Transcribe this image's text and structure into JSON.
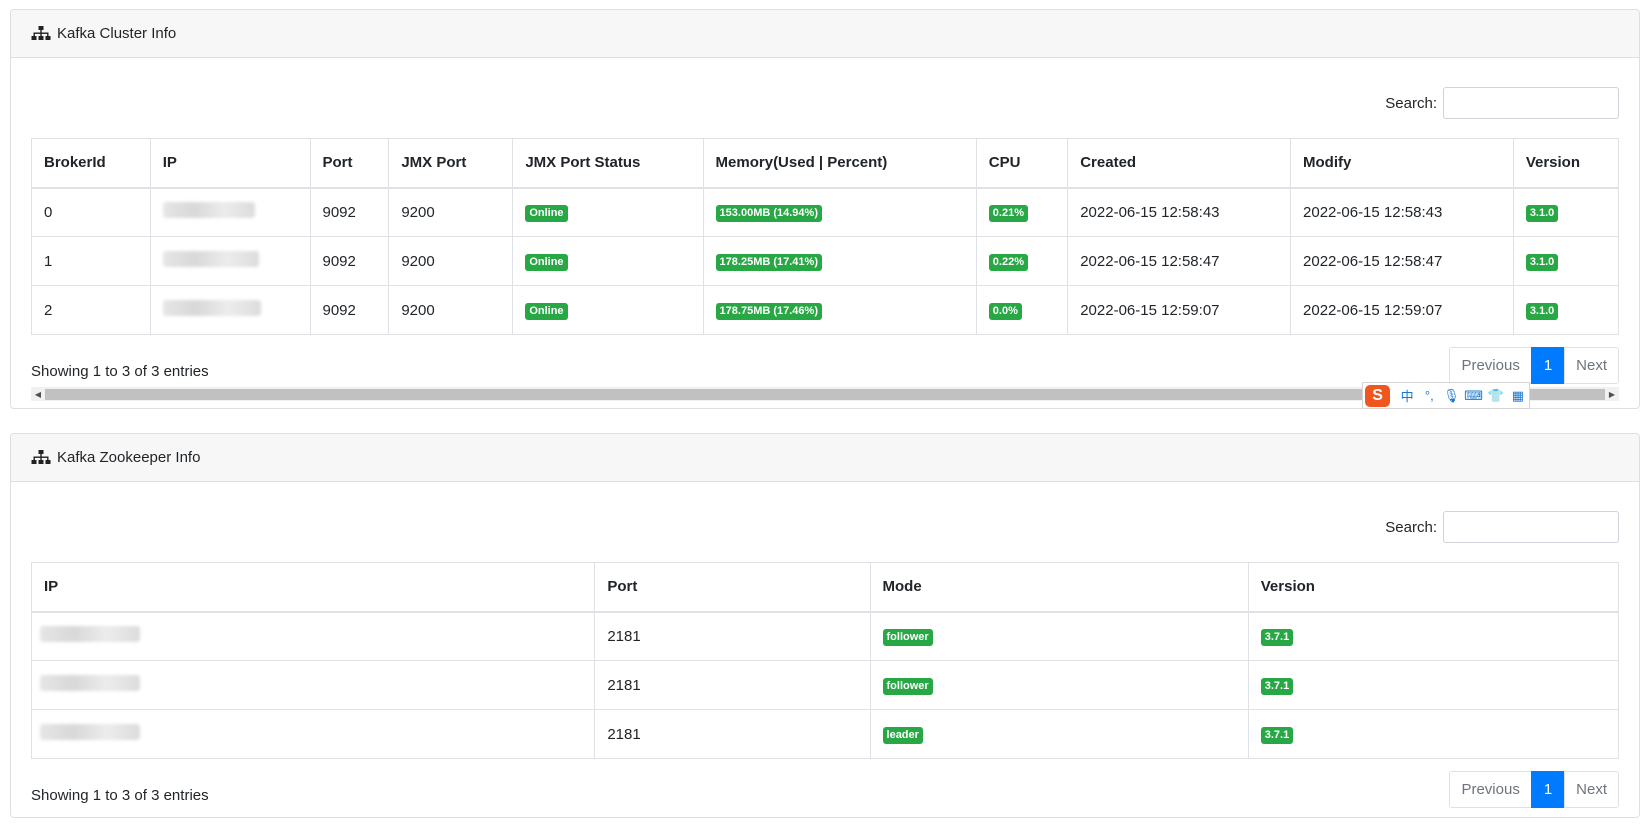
{
  "cluster": {
    "title": "Kafka Cluster Info",
    "search_label": "Search:",
    "columns": [
      "BrokerId",
      "IP",
      "Port",
      "JMX Port",
      "JMX Port Status",
      "Memory(Used | Percent)",
      "CPU",
      "Created",
      "Modify",
      "Version"
    ],
    "rows": [
      {
        "broker_id": "0",
        "port": "9092",
        "jmx_port": "9200",
        "jmx_status": "Online",
        "memory": "153.00MB (14.94%)",
        "cpu": "0.21%",
        "created": "2022-06-15 12:58:43",
        "modify": "2022-06-15 12:58:43",
        "version": "3.1.0"
      },
      {
        "broker_id": "1",
        "port": "9092",
        "jmx_port": "9200",
        "jmx_status": "Online",
        "memory": "178.25MB (17.41%)",
        "cpu": "0.22%",
        "created": "2022-06-15 12:58:47",
        "modify": "2022-06-15 12:58:47",
        "version": "3.1.0"
      },
      {
        "broker_id": "2",
        "port": "9092",
        "jmx_port": "9200",
        "jmx_status": "Online",
        "memory": "178.75MB (17.46%)",
        "cpu": "0.0%",
        "created": "2022-06-15 12:59:07",
        "modify": "2022-06-15 12:59:07",
        "version": "3.1.0"
      }
    ],
    "info": "Showing 1 to 3 of 3 entries",
    "pager": {
      "previous": "Previous",
      "current": "1",
      "next": "Next"
    }
  },
  "zookeeper": {
    "title": "Kafka Zookeeper Info",
    "search_label": "Search:",
    "columns": [
      "IP",
      "Port",
      "Mode",
      "Version"
    ],
    "rows": [
      {
        "port": "2181",
        "mode": "follower",
        "version": "3.7.1"
      },
      {
        "port": "2181",
        "mode": "follower",
        "version": "3.7.1"
      },
      {
        "port": "2181",
        "mode": "leader",
        "version": "3.7.1"
      }
    ],
    "info": "Showing 1 to 3 of 3 entries",
    "pager": {
      "previous": "Previous",
      "current": "1",
      "next": "Next"
    }
  },
  "ime": {
    "logo": "S",
    "glyphs": [
      "中",
      "°,",
      "🎙",
      "⌨",
      "👕",
      "▦"
    ]
  },
  "colors": {
    "badge": "#28a745",
    "active_page": "#007bff",
    "header_bg": "#f7f7f7"
  }
}
